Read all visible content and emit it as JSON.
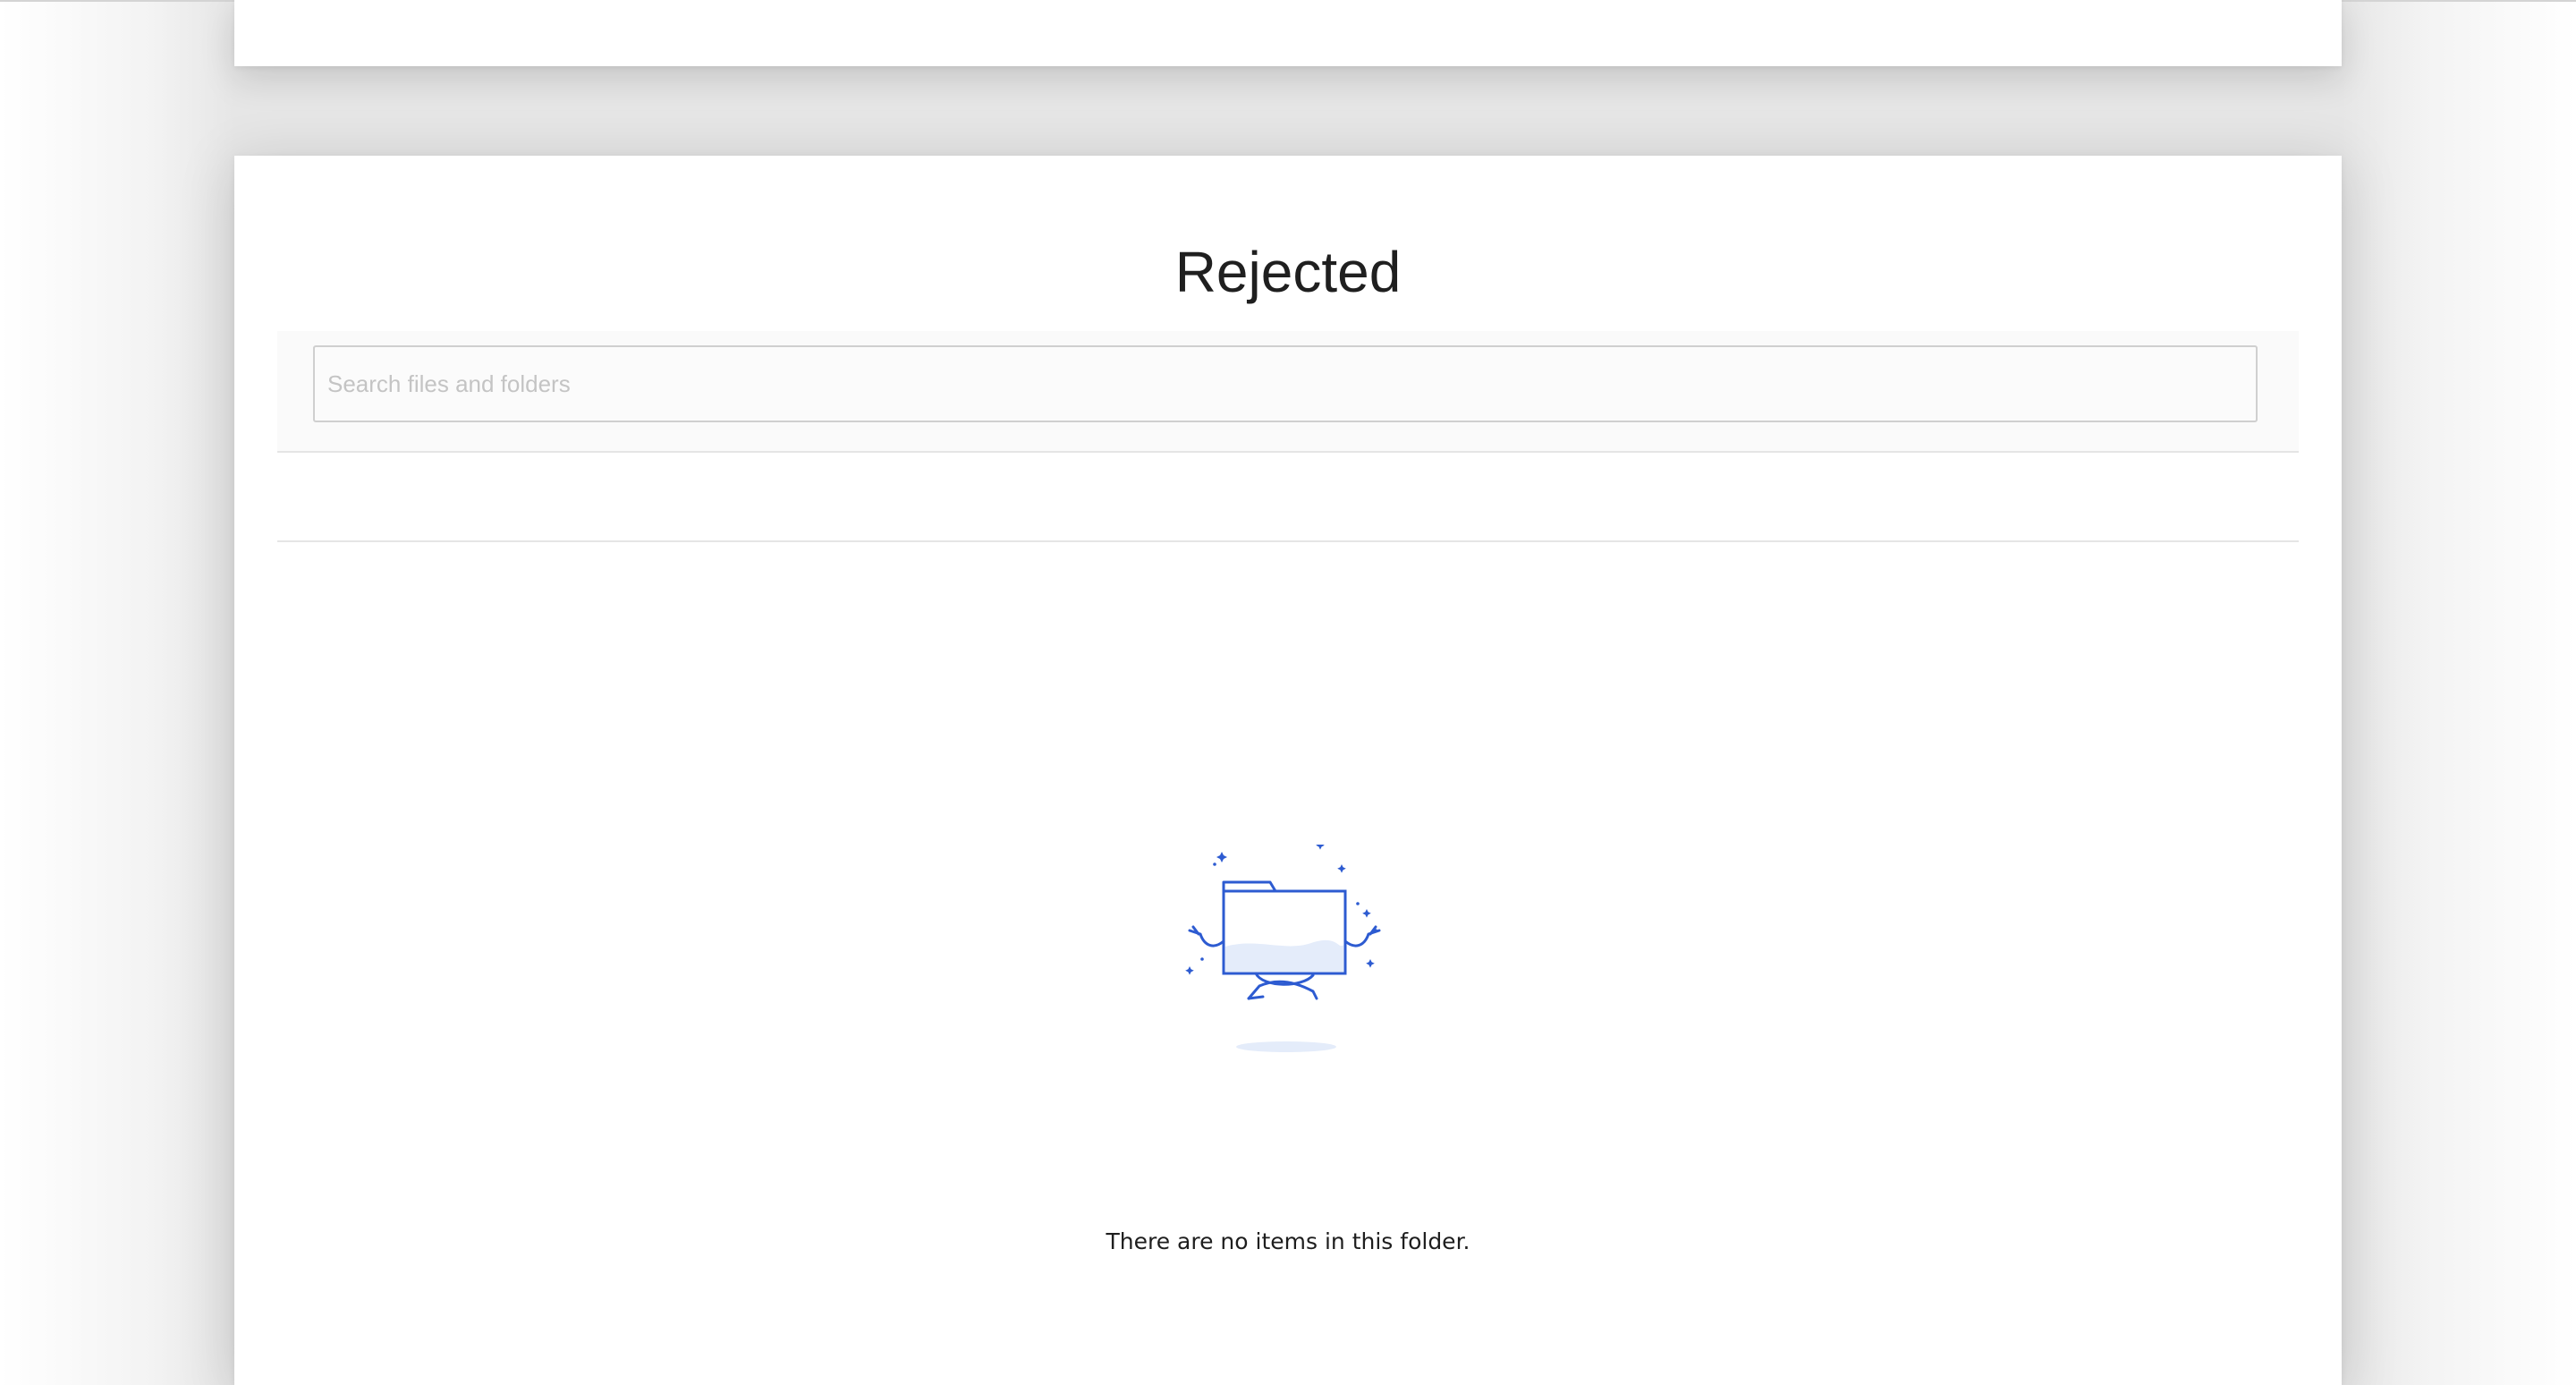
{
  "page": {
    "title": "Rejected"
  },
  "search": {
    "placeholder": "Search files and folders",
    "value": ""
  },
  "empty_state": {
    "illustration_icon": "meditating-folder-icon",
    "message": "There are no items in this folder."
  },
  "colors": {
    "accent": "#2d5bd1",
    "illustration_fill": "#e4ecfa",
    "title_text": "#1f1f1f",
    "placeholder_text": "#c4c4c4",
    "divider": "#e5e5e5"
  }
}
